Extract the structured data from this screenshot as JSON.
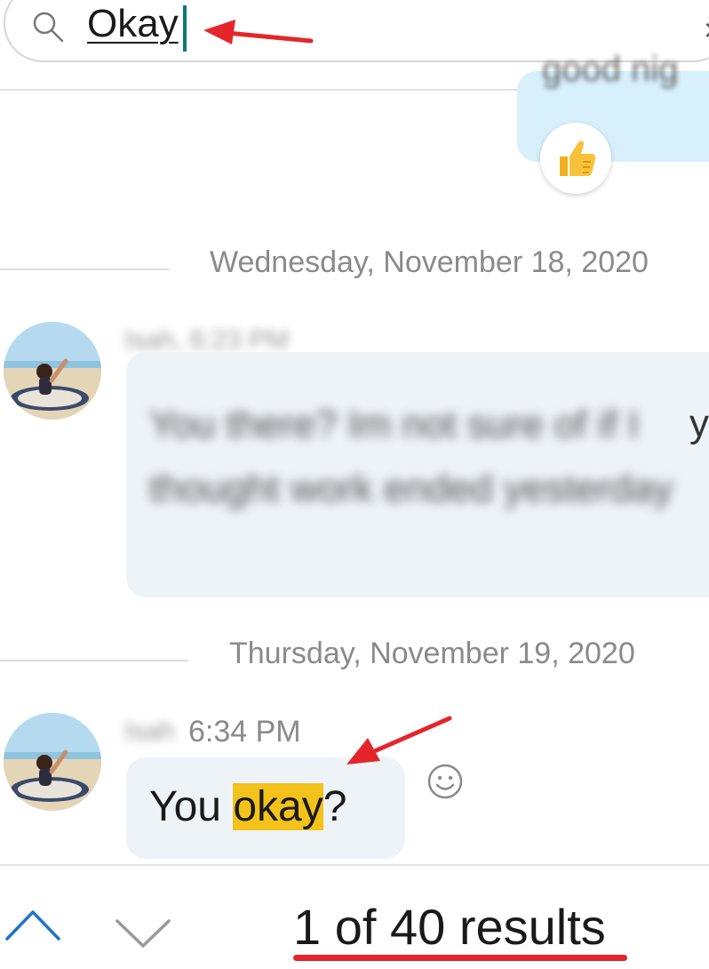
{
  "search": {
    "query": "Okay",
    "clear_glyph": "×"
  },
  "outgoing": {
    "snippet": "good nig",
    "reaction_icon": "thumbs-up-icon"
  },
  "dates": {
    "first": "Wednesday, November 18, 2020",
    "second": "Thursday, November 19, 2020"
  },
  "messages": [
    {
      "sender_blurred": "Isah, 6:23 PM",
      "text": "You there? Im not sure of if I thought work ended yesterday",
      "peek": "y"
    },
    {
      "sender_blurred": "Isah",
      "time": "6:34 PM",
      "text_before": "You ",
      "text_match": "okay",
      "text_after": "?"
    }
  ],
  "footer": {
    "results": "1 of 40 results"
  },
  "colors": {
    "accent": "#0d7a6f",
    "highlight": "#f3c21b",
    "annotation": "#e4262c",
    "nav_arrow": "#1e73c8"
  }
}
